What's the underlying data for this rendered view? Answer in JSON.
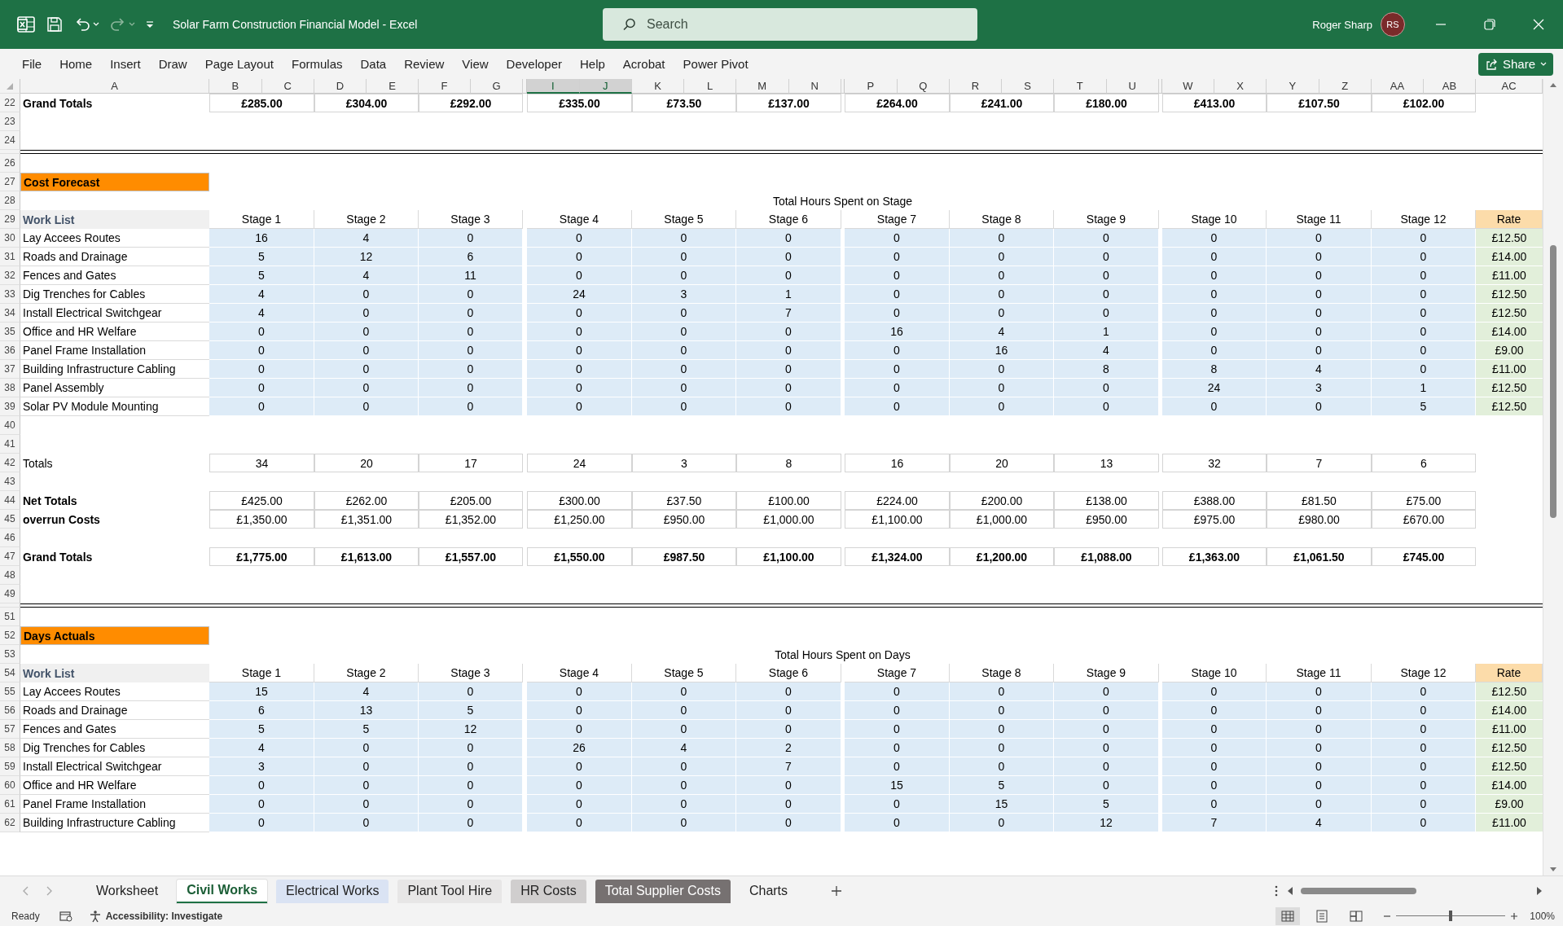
{
  "title_bar": {
    "quick_access": [
      {
        "kind": "save",
        "disabled": false
      },
      {
        "kind": "undo",
        "disabled": false
      },
      {
        "kind": "redo",
        "disabled": true
      }
    ],
    "title": "Solar Farm Construction Financial Model - Excel",
    "search": {
      "placeholder": "Search"
    },
    "user": {
      "name": "Roger Sharp",
      "initials": "RS"
    }
  },
  "ribbon": {
    "tabs": [
      "File",
      "Home",
      "Insert",
      "Draw",
      "Page Layout",
      "Formulas",
      "Data",
      "Review",
      "View",
      "Developer",
      "Help",
      "Acrobat",
      "Power Pivot"
    ],
    "share": "Share"
  },
  "sheet": {
    "columns": [
      {
        "letter": "A",
        "selected": false
      },
      {
        "letter": "B",
        "selected": false
      },
      {
        "letter": "C",
        "selected": false
      },
      {
        "letter": "D",
        "selected": false
      },
      {
        "letter": "E",
        "selected": false
      },
      {
        "letter": "F",
        "selected": false
      },
      {
        "letter": "G",
        "selected": false
      },
      {
        "letter": "I",
        "selected": true
      },
      {
        "letter": "J",
        "selected": true
      },
      {
        "letter": "K",
        "selected": false
      },
      {
        "letter": "L",
        "selected": false
      },
      {
        "letter": "M",
        "selected": false
      },
      {
        "letter": "N",
        "selected": false
      },
      {
        "letter": "P",
        "selected": false
      },
      {
        "letter": "Q",
        "selected": false
      },
      {
        "letter": "R",
        "selected": false
      },
      {
        "letter": "S",
        "selected": false
      },
      {
        "letter": "T",
        "selected": false
      },
      {
        "letter": "U",
        "selected": false
      },
      {
        "letter": "W",
        "selected": false
      },
      {
        "letter": "X",
        "selected": false
      },
      {
        "letter": "Y",
        "selected": false
      },
      {
        "letter": "Z",
        "selected": false
      },
      {
        "letter": "AA",
        "selected": false
      },
      {
        "letter": "AB",
        "selected": false
      },
      {
        "letter": "AC",
        "selected": false
      }
    ],
    "rows": [
      {
        "number": "22",
        "kind": "grand",
        "label": "Grand Totals",
        "values": [
          "£285.00",
          "£304.00",
          "£292.00",
          "£335.00",
          "£73.50",
          "£137.00",
          "£264.00",
          "£241.00",
          "£180.00",
          "£413.00",
          "£107.50",
          "£102.00"
        ]
      },
      {
        "number": "23",
        "kind": "blank"
      },
      {
        "number": "24",
        "kind": "blank"
      },
      {
        "kind": "divider"
      },
      {
        "number": "26",
        "kind": "blank"
      },
      {
        "number": "27",
        "kind": "section",
        "label": "Cost Forecast"
      },
      {
        "number": "28",
        "kind": "caption",
        "label": "Total Hours Spent on Stage"
      },
      {
        "number": "29",
        "kind": "header",
        "label": "Work List",
        "values": [
          "Stage 1",
          "Stage 2",
          "Stage 3",
          "Stage 4",
          "Stage 5",
          "Stage 6",
          "Stage 7",
          "Stage 8",
          "Stage 9",
          "Stage 10",
          "Stage 11",
          "Stage 12"
        ],
        "rate": "Rate"
      },
      {
        "number": "30",
        "kind": "data",
        "label": "Lay Accees Routes",
        "values": [
          "16",
          "4",
          "0",
          "0",
          "0",
          "0",
          "0",
          "0",
          "0",
          "0",
          "0",
          "0"
        ],
        "rate": "£12.50"
      },
      {
        "number": "31",
        "kind": "data",
        "label": "Roads and Drainage",
        "values": [
          "5",
          "12",
          "6",
          "0",
          "0",
          "0",
          "0",
          "0",
          "0",
          "0",
          "0",
          "0"
        ],
        "rate": "£14.00"
      },
      {
        "number": "32",
        "kind": "data",
        "label": "Fences and Gates",
        "values": [
          "5",
          "4",
          "11",
          "0",
          "0",
          "0",
          "0",
          "0",
          "0",
          "0",
          "0",
          "0"
        ],
        "rate": "£11.00"
      },
      {
        "number": "33",
        "kind": "data",
        "label": "Dig Trenches for Cables",
        "values": [
          "4",
          "0",
          "0",
          "24",
          "3",
          "1",
          "0",
          "0",
          "0",
          "0",
          "0",
          "0"
        ],
        "rate": "£12.50"
      },
      {
        "number": "34",
        "kind": "data",
        "label": "Install Electrical Switchgear",
        "values": [
          "4",
          "0",
          "0",
          "0",
          "0",
          "7",
          "0",
          "0",
          "0",
          "0",
          "0",
          "0"
        ],
        "rate": "£12.50"
      },
      {
        "number": "35",
        "kind": "data",
        "label": "Office and HR Welfare",
        "values": [
          "0",
          "0",
          "0",
          "0",
          "0",
          "0",
          "16",
          "4",
          "1",
          "0",
          "0",
          "0"
        ],
        "rate": "£14.00"
      },
      {
        "number": "36",
        "kind": "data",
        "label": "Panel Frame Installation",
        "values": [
          "0",
          "0",
          "0",
          "0",
          "0",
          "0",
          "0",
          "16",
          "4",
          "0",
          "0",
          "0"
        ],
        "rate": "£9.00"
      },
      {
        "number": "37",
        "kind": "data",
        "label": "Building Infrastructure Cabling",
        "values": [
          "0",
          "0",
          "0",
          "0",
          "0",
          "0",
          "0",
          "0",
          "8",
          "8",
          "4",
          "0"
        ],
        "rate": "£11.00"
      },
      {
        "number": "38",
        "kind": "data",
        "label": "Panel Assembly",
        "values": [
          "0",
          "0",
          "0",
          "0",
          "0",
          "0",
          "0",
          "0",
          "0",
          "24",
          "3",
          "1"
        ],
        "rate": "£12.50"
      },
      {
        "number": "39",
        "kind": "data",
        "label": "Solar PV Module Mounting",
        "values": [
          "0",
          "0",
          "0",
          "0",
          "0",
          "0",
          "0",
          "0",
          "0",
          "0",
          "0",
          "5"
        ],
        "rate": "£12.50"
      },
      {
        "number": "40",
        "kind": "blank"
      },
      {
        "number": "41",
        "kind": "blank"
      },
      {
        "number": "42",
        "kind": "totals",
        "label": "Totals",
        "values": [
          "34",
          "20",
          "17",
          "24",
          "3",
          "8",
          "16",
          "20",
          "13",
          "32",
          "7",
          "6"
        ]
      },
      {
        "number": "43",
        "kind": "blank"
      },
      {
        "number": "44",
        "kind": "money",
        "label": "Net Totals",
        "values": [
          "£425.00",
          "£262.00",
          "£205.00",
          "£300.00",
          "£37.50",
          "£100.00",
          "£224.00",
          "£200.00",
          "£138.00",
          "£388.00",
          "£81.50",
          "£75.00"
        ]
      },
      {
        "number": "45",
        "kind": "money",
        "label": "overrun Costs",
        "values": [
          "£1,350.00",
          "£1,351.00",
          "£1,352.00",
          "£1,250.00",
          "£950.00",
          "£1,000.00",
          "£1,100.00",
          "£1,000.00",
          "£950.00",
          "£975.00",
          "£980.00",
          "£670.00"
        ]
      },
      {
        "number": "46",
        "kind": "blank"
      },
      {
        "number": "47",
        "kind": "grand",
        "label": "Grand Totals",
        "values": [
          "£1,775.00",
          "£1,613.00",
          "£1,557.00",
          "£1,550.00",
          "£987.50",
          "£1,100.00",
          "£1,324.00",
          "£1,200.00",
          "£1,088.00",
          "£1,363.00",
          "£1,061.50",
          "£745.00"
        ]
      },
      {
        "number": "48",
        "kind": "blank"
      },
      {
        "number": "49",
        "kind": "blank"
      },
      {
        "kind": "divider"
      },
      {
        "number": "51",
        "kind": "blank"
      },
      {
        "number": "52",
        "kind": "section",
        "label": "Days Actuals"
      },
      {
        "number": "53",
        "kind": "caption",
        "label": "Total Hours Spent on Days"
      },
      {
        "number": "54",
        "kind": "header",
        "label": "Work List",
        "values": [
          "Stage 1",
          "Stage 2",
          "Stage 3",
          "Stage 4",
          "Stage 5",
          "Stage 6",
          "Stage 7",
          "Stage 8",
          "Stage 9",
          "Stage 10",
          "Stage 11",
          "Stage 12"
        ],
        "rate": "Rate"
      },
      {
        "number": "55",
        "kind": "data",
        "label": "Lay Accees Routes",
        "values": [
          "15",
          "4",
          "0",
          "0",
          "0",
          "0",
          "0",
          "0",
          "0",
          "0",
          "0",
          "0"
        ],
        "rate": "£12.50"
      },
      {
        "number": "56",
        "kind": "data",
        "label": "Roads and Drainage",
        "values": [
          "6",
          "13",
          "5",
          "0",
          "0",
          "0",
          "0",
          "0",
          "0",
          "0",
          "0",
          "0"
        ],
        "rate": "£14.00"
      },
      {
        "number": "57",
        "kind": "data",
        "label": "Fences and Gates",
        "values": [
          "5",
          "5",
          "12",
          "0",
          "0",
          "0",
          "0",
          "0",
          "0",
          "0",
          "0",
          "0"
        ],
        "rate": "£11.00"
      },
      {
        "number": "58",
        "kind": "data",
        "label": "Dig Trenches for Cables",
        "values": [
          "4",
          "0",
          "0",
          "26",
          "4",
          "2",
          "0",
          "0",
          "0",
          "0",
          "0",
          "0"
        ],
        "rate": "£12.50"
      },
      {
        "number": "59",
        "kind": "data",
        "label": "Install Electrical Switchgear",
        "values": [
          "3",
          "0",
          "0",
          "0",
          "0",
          "7",
          "0",
          "0",
          "0",
          "0",
          "0",
          "0"
        ],
        "rate": "£12.50"
      },
      {
        "number": "60",
        "kind": "data",
        "label": "Office and HR Welfare",
        "values": [
          "0",
          "0",
          "0",
          "0",
          "0",
          "0",
          "15",
          "5",
          "0",
          "0",
          "0",
          "0"
        ],
        "rate": "£14.00"
      },
      {
        "number": "61",
        "kind": "data",
        "label": "Panel Frame Installation",
        "values": [
          "0",
          "0",
          "0",
          "0",
          "0",
          "0",
          "0",
          "15",
          "5",
          "0",
          "0",
          "0"
        ],
        "rate": "£9.00"
      },
      {
        "number": "62",
        "kind": "data",
        "label": "Building Infrastructure Cabling",
        "values": [
          "0",
          "0",
          "0",
          "0",
          "0",
          "0",
          "0",
          "0",
          "12",
          "7",
          "4",
          "0"
        ],
        "rate": "£11.00"
      }
    ]
  },
  "sheet_tabs": [
    {
      "label": "Worksheet",
      "selected": false
    },
    {
      "label": "Civil Works",
      "selected": true
    },
    {
      "label": "Electrical Works",
      "selected": false,
      "color": "#dae3f3"
    },
    {
      "label": "Plant Tool Hire",
      "selected": false,
      "color": "#e7e6e6"
    },
    {
      "label": "HR Costs",
      "selected": false,
      "color": "#d0cece"
    },
    {
      "label": "Total Supplier Costs",
      "selected": false,
      "color": "#767171"
    },
    {
      "label": "Charts",
      "selected": false
    }
  ],
  "status_bar": {
    "mode": "Ready",
    "accessibility": "Accessibility: Investigate",
    "views": [
      {
        "kind": "normal",
        "selected": true
      },
      {
        "kind": "page_layout",
        "selected": false
      },
      {
        "kind": "page_break",
        "selected": false
      }
    ],
    "zoom_slider": {
      "level": 0.5
    },
    "zoom": "100%"
  }
}
